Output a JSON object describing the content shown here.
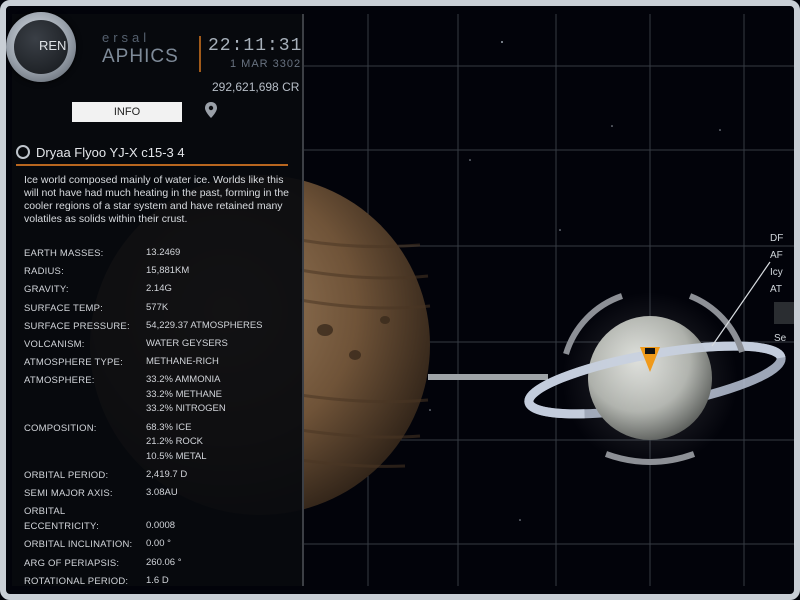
{
  "header": {
    "brand_top": "ersal",
    "brand_bottom": "APHICS",
    "time": "22:11:31",
    "date": "1 MAR 3302",
    "credits": "292,621,698 CR",
    "badge": "REN"
  },
  "tabs": {
    "info": "INFO",
    "map_icon": "map-pin-icon"
  },
  "body": {
    "title": "Dryaa Flyoo YJ-X c15-3 4",
    "description": "Ice world composed mainly of water ice. Worlds like this will not have had much heating in the past, forming in the cooler regions of a star system and have retained many volatiles as solids within their crust."
  },
  "properties": [
    {
      "label": "EARTH MASSES:",
      "values": [
        "13.2469"
      ]
    },
    {
      "label": "RADIUS:",
      "values": [
        "15,881KM"
      ]
    },
    {
      "label": "GRAVITY:",
      "values": [
        "2.14G"
      ]
    },
    {
      "label": "SURFACE TEMP:",
      "values": [
        "577K"
      ]
    },
    {
      "label": "SURFACE PRESSURE:",
      "values": [
        "54,229.37 ATMOSPHERES"
      ]
    },
    {
      "label": "VOLCANISM:",
      "values": [
        "WATER GEYSERS"
      ]
    },
    {
      "label": "ATMOSPHERE TYPE:",
      "values": [
        "METHANE-RICH"
      ]
    },
    {
      "label": "ATMOSPHERE:",
      "values": [
        "33.2% AMMONIA",
        "33.2% METHANE",
        "33.2% NITROGEN"
      ]
    },
    {
      "label": "COMPOSITION:",
      "values": [
        "68.3% ICE",
        "21.2% ROCK",
        "10.5% METAL"
      ]
    },
    {
      "label": "ORBITAL PERIOD:",
      "values": [
        "2,419.7 D"
      ]
    },
    {
      "label": "SEMI MAJOR AXIS:",
      "values": [
        "3.08AU"
      ]
    },
    {
      "label": "ORBITAL\nECCENTRICITY:",
      "values": [
        "0.0008"
      ]
    },
    {
      "label": "ORBITAL INCLINATION:",
      "values": [
        "0.00 °"
      ]
    },
    {
      "label": "ARG OF PERIAPSIS:",
      "values": [
        "260.06 °"
      ]
    },
    {
      "label": "ROTATIONAL PERIOD:",
      "values": [
        "1.6 D"
      ]
    }
  ],
  "target_label": {
    "line1": "DF",
    "line2": "AF",
    "line3": "Icy",
    "line4": "AT",
    "line5": "Se"
  },
  "colors": {
    "accent": "#b8661f",
    "panel_bg": "#0a0c10",
    "grid": "#3a3f47",
    "marker": "#f09a1a"
  }
}
